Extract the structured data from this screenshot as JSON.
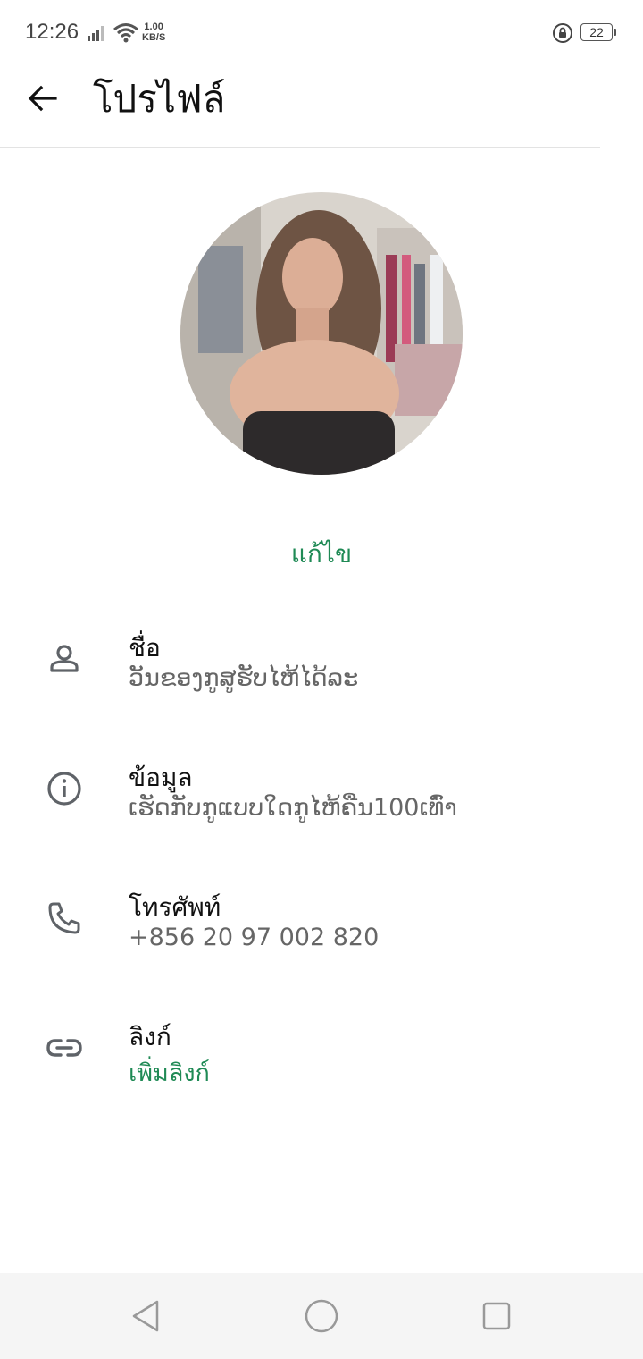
{
  "status_bar": {
    "time": "12:26",
    "net_speed_value": "1.00",
    "net_speed_unit": "KB/S",
    "battery": "22",
    "icons": [
      "signal-icon",
      "wifi-icon",
      "rotation-lock-icon",
      "battery-icon"
    ]
  },
  "header": {
    "title": "โปรไฟล์",
    "back_icon": "arrow-left-icon"
  },
  "profile": {
    "edit_label": "แก้ไข"
  },
  "rows": [
    {
      "icon": "person-icon",
      "title": "ชื่อ",
      "value": "ວັນຂອງກູສູຮັບໄຫ້ໄດ້ລະ"
    },
    {
      "icon": "info-icon",
      "title": "ข้อมูล",
      "value": "ເຮັດກັບກູແບບໃດກູໄຫ້ຄືນ100ເທົ່າ"
    },
    {
      "icon": "phone-icon",
      "title": "โทรศัพท์",
      "value": "+856 20 97 002 820"
    },
    {
      "icon": "link-icon",
      "title": "ลิงก์",
      "value": "เพิ่มลิงก์"
    }
  ],
  "colors": {
    "accent": "#1f8a55",
    "icon_gray": "#5f6368",
    "nav_bg": "#f5f5f5"
  },
  "nav_bar": {
    "buttons": [
      "back-triangle-icon",
      "home-circle-icon",
      "recents-square-icon"
    ]
  }
}
